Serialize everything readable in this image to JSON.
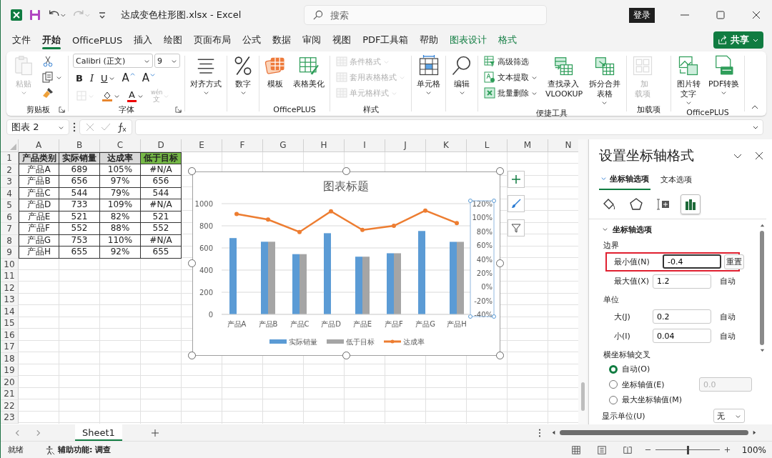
{
  "title_bar": {
    "title": "达成变色柱形图.xlsx - Excel",
    "search_placeholder": "搜索",
    "sign_in": "登录"
  },
  "menu_tabs": [
    {
      "label": "文件",
      "selected": false,
      "kind": "normal"
    },
    {
      "label": "开始",
      "selected": true,
      "kind": "normal"
    },
    {
      "label": "OfficePLUS",
      "selected": false,
      "kind": "normal"
    },
    {
      "label": "插入",
      "selected": false,
      "kind": "normal"
    },
    {
      "label": "绘图",
      "selected": false,
      "kind": "normal"
    },
    {
      "label": "页面布局",
      "selected": false,
      "kind": "normal"
    },
    {
      "label": "公式",
      "selected": false,
      "kind": "normal"
    },
    {
      "label": "数据",
      "selected": false,
      "kind": "normal"
    },
    {
      "label": "审阅",
      "selected": false,
      "kind": "normal"
    },
    {
      "label": "视图",
      "selected": false,
      "kind": "normal"
    },
    {
      "label": "PDF工具箱",
      "selected": false,
      "kind": "normal"
    },
    {
      "label": "帮助",
      "selected": false,
      "kind": "normal"
    },
    {
      "label": "图表设计",
      "selected": false,
      "kind": "contextual"
    },
    {
      "label": "格式",
      "selected": false,
      "kind": "contextual"
    }
  ],
  "share_button": "共享",
  "ribbon": {
    "groups": [
      {
        "kind": "buttons",
        "label": "剪贴板",
        "launcher": true,
        "items": [
          {
            "kind": "large",
            "label": "粘贴",
            "disabled": true,
            "caret": true
          },
          {
            "kind": "icon",
            "disabled": false,
            "caret": false
          },
          {
            "kind": "icon",
            "disabled": false,
            "caret": true
          },
          {
            "kind": "icon",
            "disabled": false,
            "caret": false
          }
        ]
      },
      {
        "kind": "font",
        "label": "字体",
        "launcher": true,
        "font": "Calibri (正文)",
        "size": "9",
        "row1": [
          {
            "text": "B",
            "kind": "bold",
            "caret": false
          },
          {
            "text": "I",
            "kind": "italic",
            "caret": false
          },
          {
            "text": "U",
            "kind": "underline",
            "caret": true
          },
          {
            "text": "A",
            "kind": "grow",
            "caret": false
          },
          {
            "text": "A",
            "kind": "shrink",
            "caret": false
          }
        ],
        "row2": [
          {
            "kind": "border",
            "disabled": true,
            "caret": true
          },
          {
            "kind": "fill",
            "disabled": false,
            "caret": true
          },
          {
            "kind": "fontcolor",
            "text": "A",
            "disabled": false,
            "caret": true
          },
          {
            "kind": "phonetic",
            "text": "wén",
            "sub": "文",
            "disabled": true,
            "caret": true
          }
        ]
      },
      {
        "kind": "buttons",
        "items": [
          {
            "kind": "large",
            "label": "对齐方式",
            "disabled": false,
            "caret": true
          }
        ]
      },
      {
        "kind": "buttons",
        "items": [
          {
            "kind": "large",
            "label": "数字",
            "disabled": false,
            "caret": true
          }
        ]
      },
      {
        "kind": "buttons",
        "label": "OfficePLUS",
        "items": [
          {
            "kind": "large",
            "label": "模板",
            "disabled": false,
            "caret": false
          },
          {
            "kind": "large",
            "label": "表格美化",
            "disabled": false,
            "caret": false
          }
        ]
      },
      {
        "kind": "buttons",
        "label": "样式",
        "items": [
          {
            "kind": "small",
            "label": "条件格式",
            "disabled": true,
            "caret": true
          },
          {
            "kind": "small",
            "label": "套用表格格式",
            "disabled": true,
            "caret": true
          },
          {
            "kind": "small",
            "label": "单元格样式",
            "disabled": true,
            "caret": true
          }
        ]
      },
      {
        "kind": "buttons",
        "items": [
          {
            "kind": "large",
            "label": "单元格",
            "disabled": false,
            "caret": true
          }
        ]
      },
      {
        "kind": "buttons",
        "items": [
          {
            "kind": "large",
            "label": "编辑",
            "disabled": false,
            "caret": true
          }
        ]
      },
      {
        "kind": "buttons",
        "label": "便捷工具",
        "items": [
          {
            "kind": "small",
            "label": "高级筛选",
            "disabled": false,
            "caret": false
          },
          {
            "kind": "small",
            "label": "文本提取",
            "disabled": false,
            "caret": true
          },
          {
            "kind": "small",
            "label": "批量删除",
            "disabled": false,
            "caret": true
          },
          {
            "kind": "large",
            "label": "查找录入 VLOOKUP",
            "disabled": false,
            "caret": false
          },
          {
            "kind": "large",
            "label": "拆分合并表格",
            "disabled": false,
            "caret": true
          }
        ]
      },
      {
        "kind": "buttons",
        "label": "加载项",
        "items": [
          {
            "kind": "large",
            "label": "加载项",
            "disabled": true,
            "caret": false
          }
        ]
      },
      {
        "kind": "buttons",
        "label": "OfficePLUS",
        "items": [
          {
            "kind": "large",
            "label": "图片转文字",
            "disabled": false,
            "caret": true
          },
          {
            "kind": "large",
            "label": "PDF转换",
            "disabled": false,
            "caret": true
          }
        ]
      }
    ]
  },
  "name_box": "图表 2",
  "columns": [
    "A",
    "B",
    "C",
    "D",
    "E",
    "F",
    "G",
    "H",
    "I",
    "J",
    "K",
    "L",
    "M",
    "N"
  ],
  "rows": [
    "1",
    "2",
    "3",
    "4",
    "5",
    "6",
    "7",
    "8",
    "9",
    "10",
    "11",
    "12",
    "13",
    "14",
    "15",
    "16",
    "17",
    "18",
    "19",
    "20",
    "21",
    "22",
    "23"
  ],
  "table": {
    "header": [
      {
        "text": "产品类别",
        "color": "#d9d9d9"
      },
      {
        "text": "实际销量",
        "color": "#d9d9d9"
      },
      {
        "text": "达成率",
        "color": "#d9d9d9"
      },
      {
        "text": "低于目标",
        "color": "#76b947"
      }
    ],
    "rows": [
      [
        "产品A",
        "689",
        "105%",
        "#N/A"
      ],
      [
        "产品B",
        "656",
        "97%",
        "656"
      ],
      [
        "产品C",
        "544",
        "79%",
        "544"
      ],
      [
        "产品D",
        "733",
        "109%",
        "#N/A"
      ],
      [
        "产品E",
        "521",
        "82%",
        "521"
      ],
      [
        "产品F",
        "552",
        "88%",
        "552"
      ],
      [
        "产品G",
        "753",
        "110%",
        "#N/A"
      ],
      [
        "产品H",
        "655",
        "92%",
        "655"
      ]
    ]
  },
  "chart": {
    "selected": true,
    "secondary_axis_selected": true,
    "chart_data": {
      "type": "bar",
      "title": "图表标题",
      "categories": [
        "产品A",
        "产品B",
        "产品C",
        "产品D",
        "产品E",
        "产品F",
        "产品G",
        "产品H"
      ],
      "series": [
        {
          "name": "实际销量",
          "color": "#5b9bd5",
          "values": [
            689,
            656,
            544,
            733,
            521,
            552,
            753,
            655
          ]
        },
        {
          "name": "低于目标",
          "color": "#a5a5a5",
          "values": [
            null,
            656,
            544,
            null,
            521,
            552,
            null,
            655
          ]
        },
        {
          "name": "达成率",
          "color": "#ed7d31",
          "type": "line",
          "axis": "y2",
          "marker": "circle",
          "values": [
            1.05,
            0.97,
            0.79,
            1.09,
            0.82,
            0.88,
            1.1,
            0.92
          ]
        }
      ],
      "stacked": false,
      "grid": true,
      "legend": "bottom",
      "ylim": [
        0,
        1000
      ],
      "yticks": [
        0,
        200,
        400,
        600,
        800,
        1000
      ],
      "y2lim": [
        -0.4,
        1.2
      ],
      "y2ticks": [
        {
          "value": -0.4,
          "label": "-40%"
        },
        {
          "value": -0.2,
          "label": "-20%"
        },
        {
          "value": 0,
          "label": "0%"
        },
        {
          "value": 0.2,
          "label": "20%"
        },
        {
          "value": 0.4,
          "label": "40%"
        },
        {
          "value": 0.6,
          "label": "60%"
        },
        {
          "value": 0.8,
          "label": "80%"
        },
        {
          "value": 1,
          "label": "100%"
        },
        {
          "value": 1.2,
          "label": "120%"
        }
      ]
    }
  },
  "format_pane": {
    "title": "设置坐标轴格式",
    "tabs": [
      {
        "label": "坐标轴选项",
        "selected": true
      },
      {
        "label": "文本选项",
        "selected": false
      }
    ],
    "icon_tabs": [
      {
        "selected": false
      },
      {
        "selected": false
      },
      {
        "selected": false
      },
      {
        "selected": true
      }
    ],
    "section": {
      "label": "坐标轴选项",
      "expanded": true
    },
    "groups": [
      {
        "label": "边界",
        "fields": [
          {
            "label": "最小值(N)",
            "value": "-0.4",
            "action": "重置",
            "modified": true,
            "highlighted": true
          },
          {
            "label": "最大值(X)",
            "value": "1.2",
            "action": "自动",
            "modified": false,
            "highlighted": false
          }
        ]
      },
      {
        "label": "单位",
        "fields": [
          {
            "label": "大(J)",
            "value": "0.2",
            "action": "自动",
            "modified": false,
            "highlighted": false
          },
          {
            "label": "小(I)",
            "value": "0.04",
            "action": "自动",
            "modified": false,
            "highlighted": false
          }
        ]
      }
    ],
    "crosses": {
      "label": "横坐标轴交叉",
      "options": [
        {
          "label": "自动(O)",
          "selected": true
        },
        {
          "label": "坐标轴值(E)",
          "selected": false,
          "value": "0.0",
          "disabled": true
        },
        {
          "label": "最大坐标轴值(M)",
          "selected": false
        }
      ]
    },
    "display_unit": {
      "label": "显示单位(U)",
      "value": "无"
    }
  },
  "sheet_tabs": [
    {
      "label": "Sheet1",
      "selected": true
    }
  ],
  "status_bar": {
    "ready": "就绪",
    "accessibility": "辅助功能: 调查",
    "zoom": "100%",
    "zoom_slider": {
      "level": 0.5
    }
  }
}
